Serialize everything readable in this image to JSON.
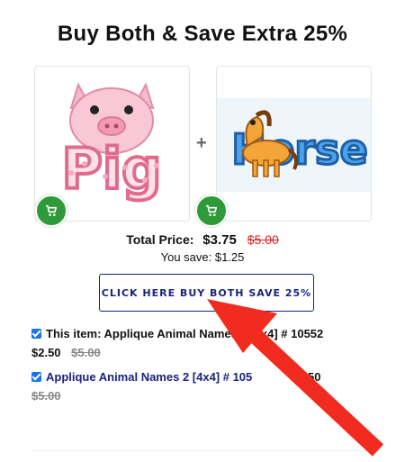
{
  "heading": "Buy Both & Save Extra 25%",
  "products": [
    {
      "name": "Pig",
      "image_text": "Pig"
    },
    {
      "name": "Horse",
      "image_text": "Horse"
    }
  ],
  "plus": "+",
  "total": {
    "label": "Total Price:",
    "price": "$3.75",
    "old_price": "$5.00"
  },
  "savings": "You save: $1.25",
  "buy_button": "CLICK HERE BUY BOTH SAVE 25%",
  "items": [
    {
      "prefix": "This item: Applique Animal ",
      "hidden_mid": "Names 2",
      "suffix": " [4x4] # 10552",
      "price": "$2.50",
      "old_price": "$5.00"
    },
    {
      "title": "Applique Animal Names 2 [4x4] # 105",
      "price": "$2.50",
      "old_price": "$5.00"
    }
  ],
  "colors": {
    "accent": "#1a237e",
    "cart": "#2f9a3a",
    "arrow": "#f12b1f",
    "old_price": "#d22222"
  }
}
